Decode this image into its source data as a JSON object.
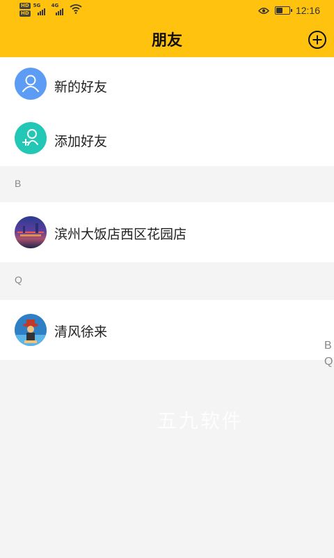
{
  "status_bar": {
    "hd_badges": [
      "HD",
      "HD"
    ],
    "network_labels": [
      "5G",
      "4G"
    ],
    "time": "12:16",
    "battery_level": 0.55
  },
  "header": {
    "title": "朋友",
    "background": "#ffc20e"
  },
  "actions": [
    {
      "label": "新的好友",
      "icon": "person-icon",
      "color": "#5d9cf5"
    },
    {
      "label": "添加好友",
      "icon": "add-person-icon",
      "color": "#22c7b6"
    }
  ],
  "sections": [
    {
      "letter": "B",
      "friends": [
        {
          "name": "滨州大饭店西区花园店",
          "avatar": "night-city-photo"
        }
      ]
    },
    {
      "letter": "Q",
      "friends": [
        {
          "name": "清风徐来",
          "avatar": "cartoon-character"
        }
      ]
    }
  ],
  "index_letters": [
    "B",
    "Q"
  ],
  "watermark": "五九软件"
}
